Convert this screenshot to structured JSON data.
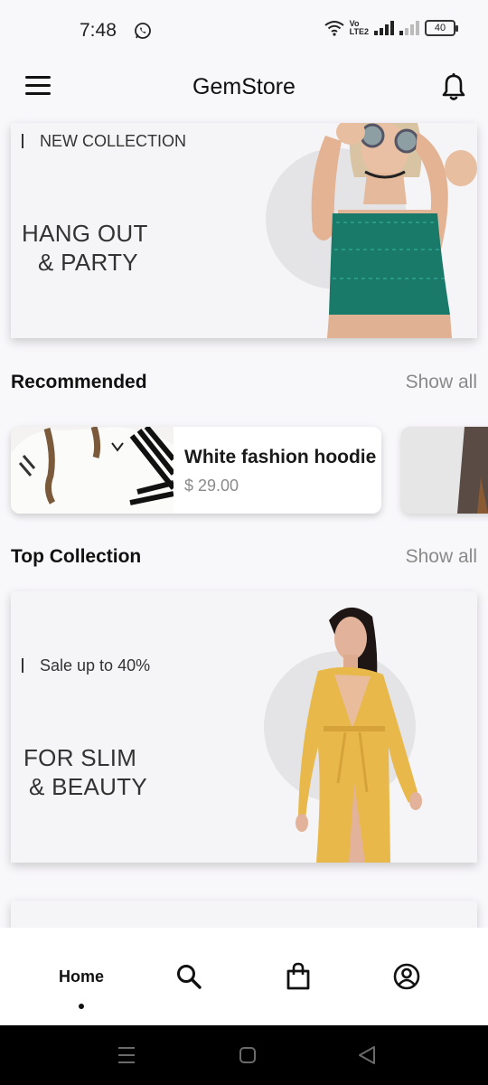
{
  "status_bar": {
    "time": "7:48",
    "volte_line1": "Vo",
    "volte_line2": "LTE2",
    "battery": "40"
  },
  "app_bar": {
    "title": "GemStore",
    "menu_icon": "hamburger-menu-icon",
    "notification_icon": "bell-icon"
  },
  "hero_banner": {
    "tagline": "NEW COLLECTION",
    "headline_line1": "HANG OUT",
    "headline_line2": "& PARTY"
  },
  "recommended": {
    "title": "Recommended",
    "show_all": "Show all",
    "products": [
      {
        "name": "White fashion hoodie",
        "price": "$ 29.00"
      }
    ]
  },
  "top_collection": {
    "title": "Top Collection",
    "show_all": "Show all",
    "banner": {
      "tagline": "Sale up to 40%",
      "headline_line1": "FOR SLIM",
      "headline_line2": "& BEAUTY"
    }
  },
  "bottom_nav": {
    "items": [
      {
        "label": "Home",
        "icon": "home",
        "active": true
      },
      {
        "label": "",
        "icon": "search-icon",
        "active": false
      },
      {
        "label": "",
        "icon": "shopping-bag-icon",
        "active": false
      },
      {
        "label": "",
        "icon": "profile-icon",
        "active": false
      }
    ]
  },
  "colors": {
    "background": "#f8f7fa",
    "card": "#ffffff",
    "muted_text": "#8a8a8a",
    "top_green": "#1a7a6a",
    "dress_yellow": "#e8b94a"
  }
}
